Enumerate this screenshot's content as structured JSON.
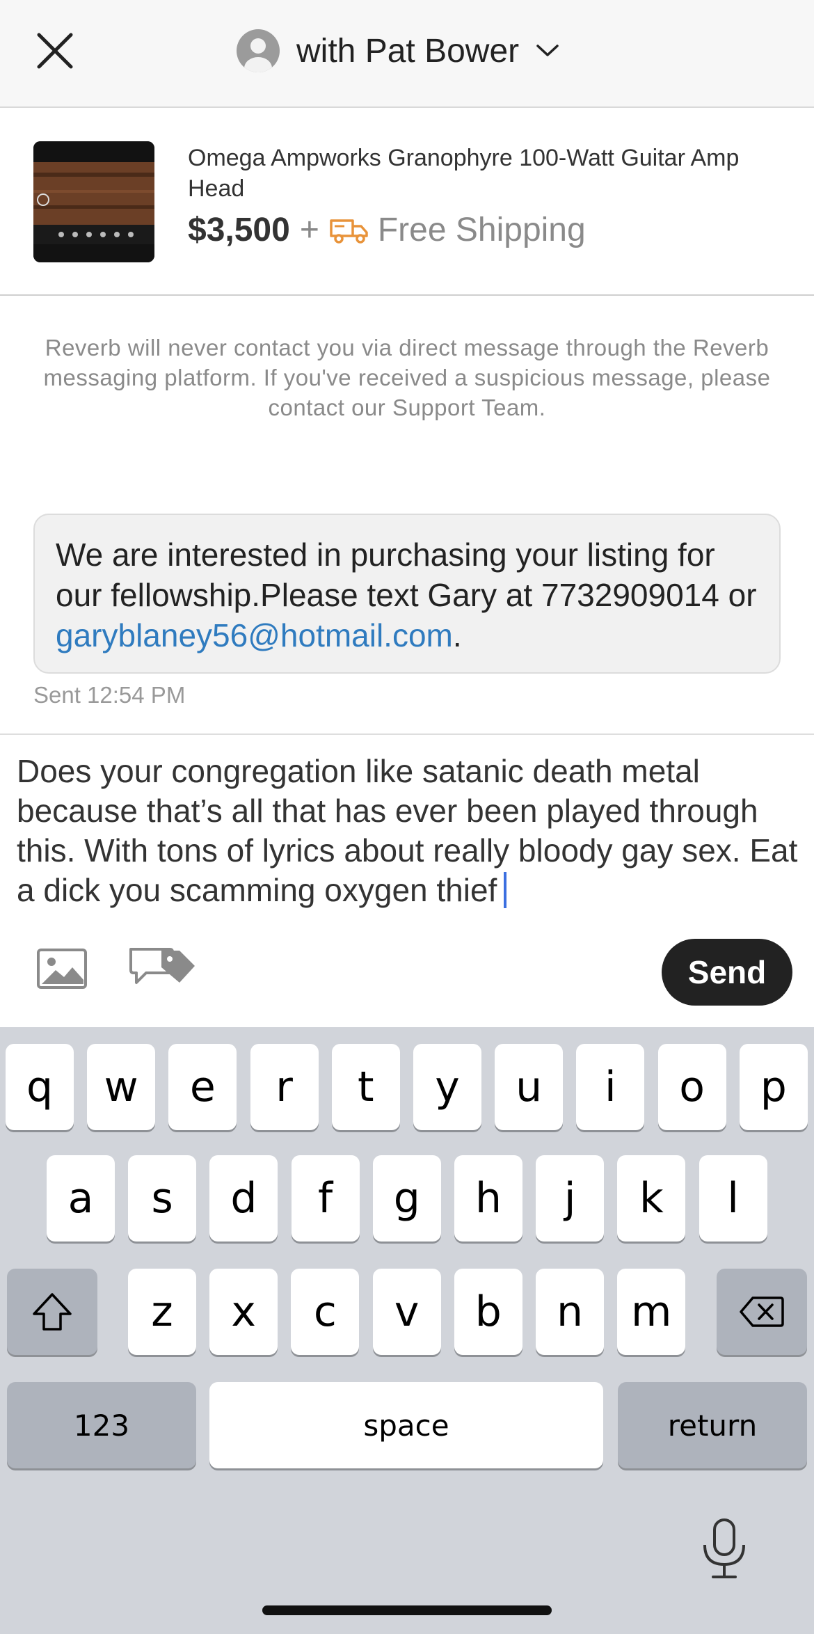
{
  "header": {
    "contact_name": "with Pat Bower",
    "close_icon": "close-icon",
    "avatar_icon": "avatar-icon",
    "dropdown_icon": "chevron-down-icon"
  },
  "listing": {
    "title": "Omega Ampworks Granophyre 100-Watt Guitar Amp Head",
    "price": "$3,500",
    "plus": "+",
    "shipping": "Free Shipping",
    "shipping_icon": "truck-icon",
    "accent_color": "#e8933a"
  },
  "notice": "Reverb will never contact you via direct message through the Reverb messaging platform. If you've received a suspicious message, please contact our Support Team.",
  "message": {
    "text_before": "We are interested in purchasing your listing for our fellowship.Please text Gary at 7732909014 or ",
    "email": "garyblaney56@hotmail.com",
    "text_after": ".",
    "sent": "Sent 12:54 PM"
  },
  "composer": {
    "draft": "Does your congregation like satanic death metal because that’s all that has ever been played through this. With tons of lyrics about really bloody gay sex. Eat a dick you scamming oxygen thief",
    "send_label": "Send",
    "image_icon": "image-icon",
    "offer_icon": "make-offer-icon"
  },
  "keyboard": {
    "row1": [
      "q",
      "w",
      "e",
      "r",
      "t",
      "y",
      "u",
      "i",
      "o",
      "p"
    ],
    "row2": [
      "a",
      "s",
      "d",
      "f",
      "g",
      "h",
      "j",
      "k",
      "l"
    ],
    "row3": [
      "z",
      "x",
      "c",
      "v",
      "b",
      "n",
      "m"
    ],
    "numbers": "123",
    "space": "space",
    "return": "return"
  }
}
